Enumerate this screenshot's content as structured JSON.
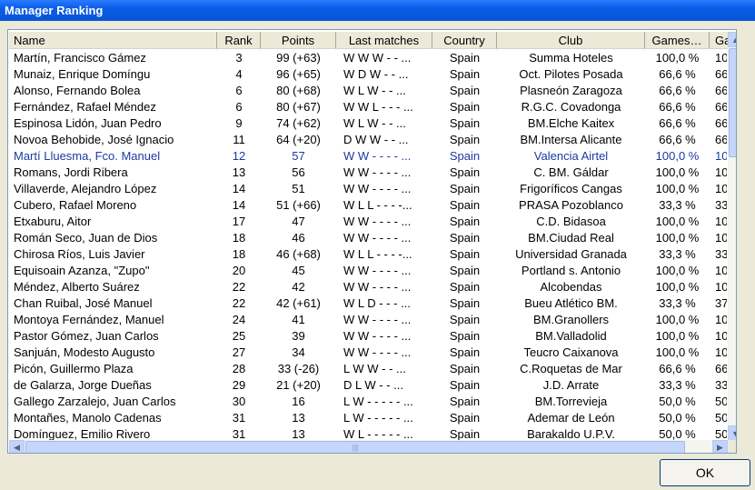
{
  "window": {
    "title": "Manager Ranking"
  },
  "columns": [
    "Name",
    "Rank",
    "Points",
    "Last matches",
    "Country",
    "Club",
    "Games…",
    "Ga"
  ],
  "rows": [
    {
      "name": "Martín, Francisco Gámez",
      "rank": "3",
      "points": "99 (+63)",
      "last": "W W W - - ...",
      "country": "Spain",
      "club": "Summa Hoteles",
      "games": "100,0 %",
      "ga": "10"
    },
    {
      "name": "Munaiz, Enrique Domíngu",
      "rank": "4",
      "points": "96 (+65)",
      "last": "W D W - - ...",
      "country": "Spain",
      "club": "Oct. Pilotes Posada",
      "games": "66,6 %",
      "ga": "66"
    },
    {
      "name": "Alonso, Fernando Bolea",
      "rank": "6",
      "points": "80 (+68)",
      "last": "W L W - - ...",
      "country": "Spain",
      "club": "Plasneón Zaragoza",
      "games": "66,6 %",
      "ga": "66"
    },
    {
      "name": "Fernández, Rafael Méndez",
      "rank": "6",
      "points": "80 (+67)",
      "last": "W W L - - - ...",
      "country": "Spain",
      "club": "R.G.C. Covadonga",
      "games": "66,6 %",
      "ga": "66"
    },
    {
      "name": "Espinosa Lidón, Juan Pedro",
      "rank": "9",
      "points": "74 (+62)",
      "last": "W L W - - ...",
      "country": "Spain",
      "club": "BM.Elche Kaitex",
      "games": "66,6 %",
      "ga": "66"
    },
    {
      "name": "Novoa Behobide, José Ignacio",
      "rank": "11",
      "points": "64 (+20)",
      "last": "D W W - - ...",
      "country": "Spain",
      "club": "BM.Intersa Alicante",
      "games": "66,6 %",
      "ga": "66"
    },
    {
      "name": "Martí Lluesma, Fco. Manuel",
      "rank": "12",
      "points": "57",
      "last": "W W - - - - ...",
      "country": "Spain",
      "club": "Valencia Airtel",
      "games": "100,0 %",
      "ga": "10",
      "selected": true
    },
    {
      "name": "Romans, Jordi Ribera",
      "rank": "13",
      "points": "56",
      "last": "W W - - - - ...",
      "country": "Spain",
      "club": "C. BM. Gáldar",
      "games": "100,0 %",
      "ga": "10"
    },
    {
      "name": "Villaverde, Alejandro López",
      "rank": "14",
      "points": "51",
      "last": "W W - - - - ...",
      "country": "Spain",
      "club": "Frigoríficos Cangas",
      "games": "100,0 %",
      "ga": "10"
    },
    {
      "name": "Cubero, Rafael Moreno",
      "rank": "14",
      "points": "51 (+66)",
      "last": "W L L - - - -...",
      "country": "Spain",
      "club": "PRASA Pozoblanco",
      "games": "33,3 %",
      "ga": "33"
    },
    {
      "name": "Etxaburu, Aitor",
      "rank": "17",
      "points": "47",
      "last": "W W - - - - ...",
      "country": "Spain",
      "club": "C.D. Bidasoa",
      "games": "100,0 %",
      "ga": "10"
    },
    {
      "name": "Román Seco, Juan de Dios",
      "rank": "18",
      "points": "46",
      "last": "W W - - - - ...",
      "country": "Spain",
      "club": "BM.Ciudad Real",
      "games": "100,0 %",
      "ga": "10"
    },
    {
      "name": "Chirosa Ríos, Luis Javier",
      "rank": "18",
      "points": "46 (+68)",
      "last": "W L L - - - -...",
      "country": "Spain",
      "club": "Universidad Granada",
      "games": "33,3 %",
      "ga": "33"
    },
    {
      "name": "Equisoain Azanza, \"Zupo\"",
      "rank": "20",
      "points": "45",
      "last": "W W - - - - ...",
      "country": "Spain",
      "club": "Portland s. Antonio",
      "games": "100,0 %",
      "ga": "10"
    },
    {
      "name": "Méndez, Alberto Suárez",
      "rank": "22",
      "points": "42",
      "last": "W W - - - - ...",
      "country": "Spain",
      "club": "Alcobendas",
      "games": "100,0 %",
      "ga": "10"
    },
    {
      "name": "Chan Ruibal, José Manuel",
      "rank": "22",
      "points": "42 (+61)",
      "last": "W L D - - - ...",
      "country": "Spain",
      "club": "Bueu Atlético BM.",
      "games": "33,3 %",
      "ga": "37"
    },
    {
      "name": "Montoya Fernández, Manuel",
      "rank": "24",
      "points": "41",
      "last": "W W - - - - ...",
      "country": "Spain",
      "club": "BM.Granollers",
      "games": "100,0 %",
      "ga": "10"
    },
    {
      "name": "Pastor Gómez, Juan Carlos",
      "rank": "25",
      "points": "39",
      "last": "W W - - - - ...",
      "country": "Spain",
      "club": "BM.Valladolid",
      "games": "100,0 %",
      "ga": "10"
    },
    {
      "name": "Sanjuán, Modesto Augusto",
      "rank": "27",
      "points": "34",
      "last": "W W - - - - ...",
      "country": "Spain",
      "club": "Teucro Caixanova",
      "games": "100,0 %",
      "ga": "10"
    },
    {
      "name": "Picón, Guillermo Plaza",
      "rank": "28",
      "points": "33 (-26)",
      "last": "L W W - - ...",
      "country": "Spain",
      "club": "C.Roquetas de Mar",
      "games": "66,6 %",
      "ga": "66"
    },
    {
      "name": "de Galarza, Jorge Dueñas",
      "rank": "29",
      "points": "21 (+20)",
      "last": "D L W - - ...",
      "country": "Spain",
      "club": "J.D. Arrate",
      "games": "33,3 %",
      "ga": "33"
    },
    {
      "name": "Gallego Zarzalejo, Juan Carlos",
      "rank": "30",
      "points": "16",
      "last": "L W - - - - - ...",
      "country": "Spain",
      "club": "BM.Torrevieja",
      "games": "50,0 %",
      "ga": "50"
    },
    {
      "name": "Montañes, Manolo Cadenas",
      "rank": "31",
      "points": "13",
      "last": "L W - - - - - ...",
      "country": "Spain",
      "club": "Ademar de León",
      "games": "50,0 %",
      "ga": "50"
    },
    {
      "name": "Domínguez, Emilio Rivero",
      "rank": "31",
      "points": "13",
      "last": "W L - - - - - ...",
      "country": "Spain",
      "club": "Barakaldo U.P.V.",
      "games": "50,0 %",
      "ga": "50"
    }
  ],
  "icons": {
    "scroll_up": "▲",
    "scroll_down": "▼",
    "scroll_left": "◀",
    "scroll_right": "▶",
    "grip": "|||"
  },
  "buttons": {
    "ok": "OK"
  },
  "colors": {
    "titlebar": "#0a5ce8",
    "selected_text": "#1c3aa3",
    "window_bg": "#ece9d8"
  }
}
